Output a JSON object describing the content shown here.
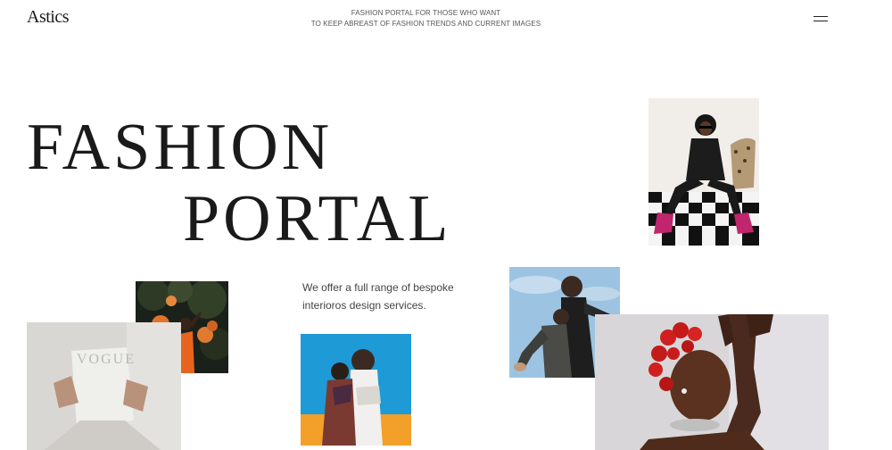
{
  "header": {
    "logo": "Astics",
    "tagline_line1": "FASHION PORTAL FOR THOSE WHO WANT",
    "tagline_line2": "TO KEEP ABREAST OF FASHION TRENDS AND CURRENT IMAGES",
    "menu_icon": "hamburger-menu-icon"
  },
  "hero": {
    "line1": "FASHION",
    "line2": "PORTAL"
  },
  "intro": {
    "text": "We offer a full range of bespoke interioros design services."
  },
  "photos": [
    "woman-sunglasses-checkered-floor",
    "woman-orange-flowers-dark-foliage",
    "person-holding-vogue-magazine",
    "two-women-blue-sky-orange",
    "two-women-low-angle-sky",
    "woman-red-hair-knots-posing"
  ]
}
